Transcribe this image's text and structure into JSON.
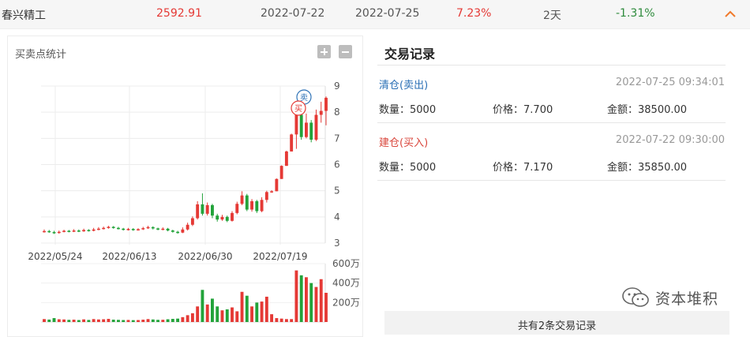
{
  "summary_row": {
    "name": "春兴精工",
    "price": "2592.91",
    "buy_date": "2022-07-22",
    "sell_date": "2022-07-25",
    "percent": "7.23%",
    "hold_days": "2天",
    "return": "-1.31%",
    "collapse_icon": "chevron-up-icon",
    "colors": {
      "up": "#e53935",
      "down": "#2e8b3c",
      "caret": "#f07a2b"
    }
  },
  "chart_panel": {
    "title": "买卖点统计",
    "zoom_in_icon": "plus-icon",
    "zoom_out_icon": "minus-icon",
    "buy_marker": "买",
    "sell_marker": "卖"
  },
  "chart_data": {
    "type": "candlestick",
    "x_ticks": [
      "2022/05/24",
      "2022/06/13",
      "2022/06/30",
      "2022/07/19"
    ],
    "y_ticks": [
      "3",
      "4",
      "5",
      "6",
      "7",
      "8",
      "9"
    ],
    "ylim": [
      3,
      9
    ],
    "volume_ticks": [
      "600万",
      "400万",
      "200万"
    ],
    "volume_lim": [
      0,
      600
    ],
    "grid": true,
    "colors": {
      "up": "#e53935",
      "down": "#22a33a"
    },
    "candles": [
      [
        3.43,
        3.46,
        3.52,
        3.4,
        30
      ],
      [
        3.46,
        3.42,
        3.5,
        3.39,
        25
      ],
      [
        3.42,
        3.39,
        3.47,
        3.35,
        40
      ],
      [
        3.39,
        3.43,
        3.48,
        3.36,
        28
      ],
      [
        3.43,
        3.47,
        3.51,
        3.41,
        26
      ],
      [
        3.47,
        3.44,
        3.5,
        3.41,
        22
      ],
      [
        3.44,
        3.48,
        3.53,
        3.42,
        24
      ],
      [
        3.48,
        3.45,
        3.52,
        3.42,
        20
      ],
      [
        3.45,
        3.5,
        3.55,
        3.43,
        27
      ],
      [
        3.5,
        3.47,
        3.53,
        3.44,
        21
      ],
      [
        3.47,
        3.52,
        3.58,
        3.45,
        30
      ],
      [
        3.52,
        3.55,
        3.61,
        3.49,
        26
      ],
      [
        3.55,
        3.58,
        3.63,
        3.52,
        28
      ],
      [
        3.58,
        3.62,
        3.66,
        3.55,
        32
      ],
      [
        3.62,
        3.58,
        3.65,
        3.55,
        24
      ],
      [
        3.58,
        3.55,
        3.62,
        3.52,
        22
      ],
      [
        3.55,
        3.51,
        3.58,
        3.48,
        20
      ],
      [
        3.51,
        3.54,
        3.58,
        3.48,
        21
      ],
      [
        3.54,
        3.5,
        3.57,
        3.47,
        19
      ],
      [
        3.5,
        3.53,
        3.57,
        3.48,
        20
      ],
      [
        3.53,
        3.57,
        3.62,
        3.5,
        24
      ],
      [
        3.57,
        3.61,
        3.66,
        3.54,
        30
      ],
      [
        3.61,
        3.56,
        3.64,
        3.52,
        26
      ],
      [
        3.56,
        3.52,
        3.59,
        3.49,
        22
      ],
      [
        3.52,
        3.55,
        3.6,
        3.49,
        23
      ],
      [
        3.55,
        3.48,
        3.58,
        3.45,
        28
      ],
      [
        3.48,
        3.43,
        3.51,
        3.4,
        32
      ],
      [
        3.43,
        3.4,
        3.47,
        3.36,
        35
      ],
      [
        3.4,
        3.52,
        3.6,
        3.38,
        50
      ],
      [
        3.52,
        3.7,
        3.78,
        3.48,
        70
      ],
      [
        3.7,
        3.95,
        4.02,
        3.65,
        90
      ],
      [
        3.95,
        4.48,
        4.6,
        3.9,
        160
      ],
      [
        4.48,
        4.12,
        4.9,
        4.05,
        330
      ],
      [
        4.12,
        4.45,
        4.55,
        4.05,
        180
      ],
      [
        4.45,
        4.05,
        4.5,
        3.95,
        240
      ],
      [
        4.05,
        3.9,
        4.12,
        3.82,
        160
      ],
      [
        3.9,
        4.0,
        4.08,
        3.85,
        120
      ],
      [
        4.0,
        3.85,
        4.05,
        3.8,
        130
      ],
      [
        3.85,
        4.15,
        4.22,
        3.82,
        150
      ],
      [
        4.15,
        4.5,
        4.58,
        4.1,
        110
      ],
      [
        4.5,
        4.82,
        4.98,
        4.45,
        310
      ],
      [
        4.82,
        4.28,
        4.88,
        4.22,
        270
      ],
      [
        4.28,
        4.6,
        4.68,
        4.2,
        160
      ],
      [
        4.6,
        4.22,
        4.65,
        4.15,
        200
      ],
      [
        4.22,
        4.65,
        4.75,
        4.18,
        210
      ],
      [
        4.65,
        4.95,
        5.0,
        4.55,
        260
      ],
      [
        4.95,
        4.98,
        5.02,
        4.92,
        80
      ],
      [
        4.98,
        5.45,
        5.47,
        4.98,
        40
      ],
      [
        5.45,
        5.95,
        5.97,
        5.45,
        35
      ],
      [
        5.95,
        6.5,
        6.53,
        5.95,
        30
      ],
      [
        6.5,
        7.15,
        7.18,
        6.5,
        30
      ],
      [
        7.15,
        7.9,
        8.1,
        6.6,
        530
      ],
      [
        7.9,
        7.05,
        7.95,
        6.95,
        480
      ],
      [
        7.05,
        7.6,
        7.95,
        7.0,
        460
      ],
      [
        7.6,
        6.95,
        7.7,
        6.85,
        400
      ],
      [
        6.95,
        7.9,
        8.1,
        6.9,
        360
      ],
      [
        7.9,
        8.05,
        8.4,
        7.6,
        440
      ],
      [
        8.05,
        8.55,
        8.6,
        7.5,
        300
      ]
    ]
  },
  "records_panel": {
    "title": "交易记录",
    "records": [
      {
        "type": "清仓(卖出)",
        "time": "2022-07-25 09:34:01",
        "qty_label": "数量：",
        "qty": "5000",
        "price_label": "价格：",
        "price": "7.700",
        "amount_label": "金额：",
        "amount": "38500.00"
      },
      {
        "type": "建仓(买入)",
        "time": "2022-07-22 09:30:00",
        "qty_label": "数量：",
        "qty": "5000",
        "price_label": "价格：",
        "price": "7.170",
        "amount_label": "金额：",
        "amount": "35850.00"
      }
    ],
    "footer": "共有2条交易记录"
  },
  "watermark": {
    "icon": "wechat-icon",
    "text": "资本堆积"
  }
}
